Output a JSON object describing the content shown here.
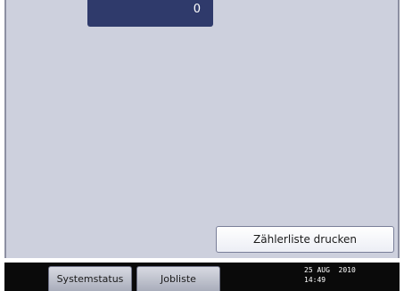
{
  "counter": {
    "value": "0"
  },
  "actions": {
    "print_counter_list_label": "Zählerliste drucken"
  },
  "status_bar": {
    "system_status_label": "Systemstatus",
    "job_list_label": "Jobliste",
    "date": "25 AUG  2010",
    "time": "14:49"
  },
  "colors": {
    "panel_background": "#cdd0dd",
    "counter_background": "#2f3a6b",
    "status_bar_background": "#0a0a0a"
  }
}
